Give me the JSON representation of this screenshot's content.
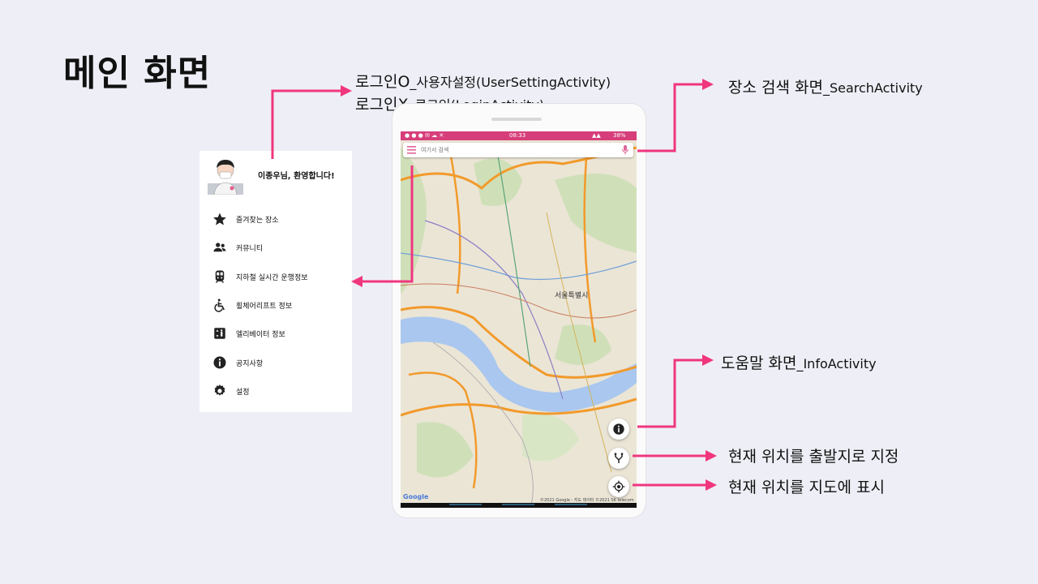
{
  "slide": {
    "title": "메인 화면"
  },
  "callouts": {
    "login_o_main": "로그인O",
    "login_o_sub": "_사용자설정(UserSettingActivity)",
    "login_x_main": "로그인X",
    "login_x_sub": "_로그인(LoginActivity)",
    "search_main": "장소 검색 화면",
    "search_sub": "_SearchActivity",
    "info_main": "도움말 화면",
    "info_sub": "_InfoActivity",
    "set_start": "현재 위치를 출발지로 지정",
    "show_location": "현재 위치를 지도에 표시"
  },
  "drawer": {
    "greeting": "이종우님, 환영합니다!",
    "items": [
      {
        "label": "즐겨찾는 장소",
        "icon": "star-icon"
      },
      {
        "label": "커뮤니티",
        "icon": "people-icon"
      },
      {
        "label": "지하철 실시간 운행정보",
        "icon": "subway-icon"
      },
      {
        "label": "휠체어리프트 정보",
        "icon": "wheelchair-icon"
      },
      {
        "label": "엘리베이터 정보",
        "icon": "elevator-icon"
      },
      {
        "label": "공지사항",
        "icon": "info-icon"
      },
      {
        "label": "설정",
        "icon": "gear-icon"
      }
    ]
  },
  "phone": {
    "status_time": "08:33",
    "status_battery": "38%",
    "search_placeholder": "여기서 검색",
    "map_city_label": "서울특별시",
    "map_google_logo": "Google",
    "map_copyright": "©2021 Google - 지도 데이터 ©2021 SK telecom",
    "colors": {
      "accent": "#d63e7a",
      "arrow": "#f0367f",
      "river": "#a9c7ef",
      "road_major": "#f29a2b"
    }
  }
}
